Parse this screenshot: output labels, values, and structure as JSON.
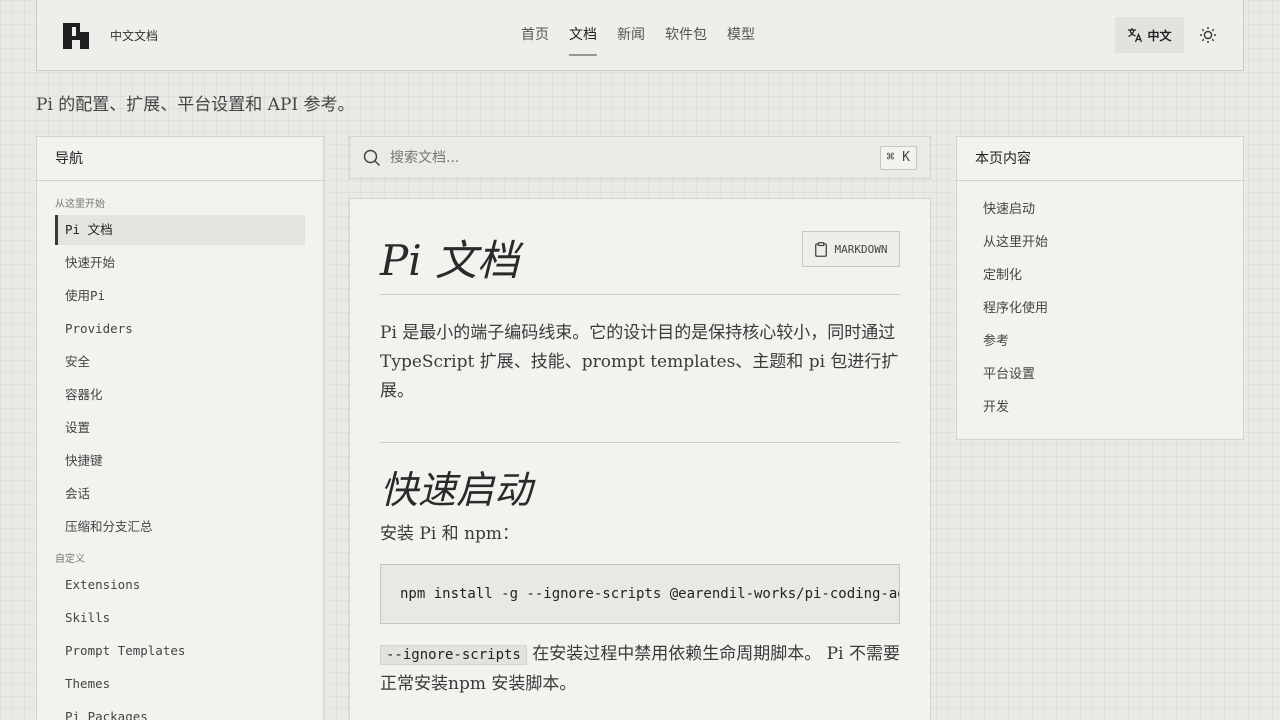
{
  "header": {
    "site_name": "中文文档",
    "nav": [
      {
        "label": "首页"
      },
      {
        "label": "文档"
      },
      {
        "label": "新闻"
      },
      {
        "label": "软件包"
      },
      {
        "label": "模型"
      }
    ],
    "active_nav": "文档",
    "language_label": "中文",
    "icons": {
      "language": "translate-icon",
      "theme": "sun-icon"
    }
  },
  "tagline": "Pi 的配置、扩展、平台设置和 API 参考。",
  "left_nav": {
    "title": "导航",
    "sections": [
      {
        "label": "从这里开始",
        "items": [
          "Pi 文档",
          "快速开始",
          "使用Pi",
          "Providers",
          "安全",
          "容器化",
          "设置",
          "快捷键",
          "会话",
          "压缩和分支汇总"
        ]
      },
      {
        "label": "自定义",
        "items": [
          "Extensions",
          "Skills",
          "Prompt Templates",
          "Themes",
          "Pi Packages"
        ]
      }
    ],
    "active_item": "Pi 文档"
  },
  "search": {
    "placeholder": "搜索文档...",
    "shortcut": "⌘ K"
  },
  "content": {
    "title": "Pi 文档",
    "markdown_button": "MARKDOWN",
    "intro": "Pi 是最小的端子编码线束。它的设计目的是保持核心较小，同时通过 TypeScript 扩展、技能、prompt templates、主题和 pi 包进行扩展。",
    "quickstart_heading": "快速启动",
    "install_text": "安装 Pi 和 npm：",
    "install_command": "npm install -g --ignore-scripts @earendil-works/pi-coding-agent",
    "note_code": "--ignore-scripts",
    "note_text": " 在安装过程中禁用依赖生命周期脚本。 Pi 不需要正常安装npm 安装脚本。"
  },
  "toc": {
    "title": "本页内容",
    "items": [
      "快速启动",
      "从这里开始",
      "定制化",
      "程序化使用",
      "参考",
      "平台设置",
      "开发"
    ]
  }
}
